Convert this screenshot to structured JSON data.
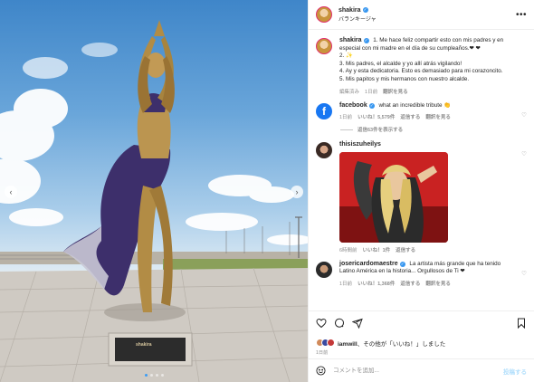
{
  "colors": {
    "accent": "#0095f6",
    "verified": "#3897f0",
    "muted": "#8e8e8e",
    "text": "#262626",
    "facebook": "#1877f2"
  },
  "header": {
    "username": "shakira",
    "subtitle": "バランキージャ",
    "more_icon": "more-horizontal-icon"
  },
  "photo": {
    "plaque_text": "shakira",
    "carousel": {
      "count": 4,
      "active": 1
    }
  },
  "caption": {
    "username": "shakira",
    "lines": [
      "1. Me hace feliz compartir esto con mis padres y en especial con mi madre en el día de su cumpleaños.❤ ❤",
      "2. ✨",
      "3. Mis padres, el alcalde y yo allí atrás vigilando!",
      "4. Ay y esta dedicatoria. Esto es demasiado para mi corazoncito.",
      "5. Mis papitos y mis hermanos con nuestro alcalde."
    ],
    "meta": {
      "edited": "編集済み",
      "time": "1日前",
      "translate": "翻訳を見る"
    }
  },
  "comments": [
    {
      "username": "facebook",
      "text": "what an incredible tribute 👏",
      "time": "1日前",
      "likes": "いいね！5,579件",
      "reply": "返信する",
      "translate": "翻訳を見る",
      "replies_label": "返信63件を表示する"
    },
    {
      "username": "thisiszuheilys",
      "text": "",
      "time": "6時間前",
      "likes": "いいね！1件",
      "reply": "返信する"
    },
    {
      "username": "josericardomaestre",
      "text": "La artista más grande que ha tenido Latino América en la historia... Orgullosos de Ti ❤",
      "time": "1日前",
      "likes": "いいね！1,368件",
      "reply": "返信する",
      "translate": "翻訳を見る"
    }
  ],
  "likes_summary": {
    "user": "iamwill",
    "suffix": "、その他が「いいね！」しました"
  },
  "post_date": "1日前",
  "add_comment": {
    "placeholder": "コメントを追加...",
    "post_label": "投稿する"
  },
  "icons": [
    "heart-icon",
    "comment-icon",
    "share-icon",
    "bookmark-icon",
    "emoji-icon",
    "verified-icon",
    "chevron-left-icon",
    "chevron-right-icon"
  ]
}
